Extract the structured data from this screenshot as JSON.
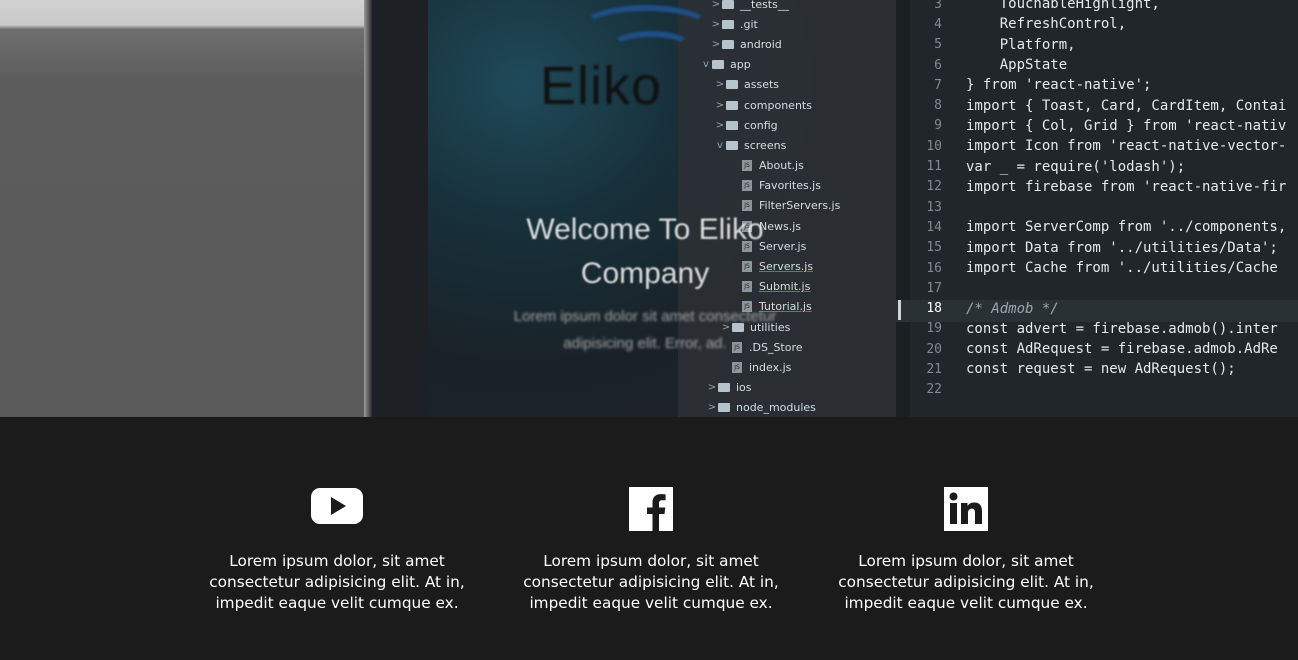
{
  "hero": {
    "logo_text": "Eliko",
    "welcome_line1": "Welcome To Eliko",
    "welcome_line2": "Company",
    "subtitle": "Lorem ipsum dolor sit amet consectetur adipisicing elit. Error, ad.",
    "file_tree": [
      {
        "type": "folder",
        "name": "__tests__",
        "chev": ">"
      },
      {
        "type": "folder",
        "name": ".git",
        "chev": ">"
      },
      {
        "type": "folder",
        "name": "android",
        "chev": ">"
      },
      {
        "type": "folder",
        "name": "app",
        "chev": "v"
      },
      {
        "type": "folder",
        "name": "assets",
        "chev": ">"
      },
      {
        "type": "folder",
        "name": "components",
        "chev": ">"
      },
      {
        "type": "folder",
        "name": "config",
        "chev": ">"
      },
      {
        "type": "folder",
        "name": "screens",
        "chev": "v"
      },
      {
        "type": "file",
        "name": "About.js"
      },
      {
        "type": "file",
        "name": "Favorites.js"
      },
      {
        "type": "file",
        "name": "FilterServers.js"
      },
      {
        "type": "file",
        "name": "News.js"
      },
      {
        "type": "file",
        "name": "Server.js"
      },
      {
        "type": "file",
        "name": "Servers.js"
      },
      {
        "type": "file",
        "name": "Submit.js"
      },
      {
        "type": "file",
        "name": "Tutorial.js"
      },
      {
        "type": "folder",
        "name": "utilities",
        "chev": ">"
      },
      {
        "type": "file",
        "name": ".DS_Store"
      },
      {
        "type": "file",
        "name": "index.js"
      },
      {
        "type": "folder",
        "name": "ios",
        "chev": ">"
      },
      {
        "type": "folder",
        "name": "node_modules",
        "chev": ">"
      }
    ],
    "code_lines": [
      {
        "ln": "3",
        "code": "    TouchableHighlight,"
      },
      {
        "ln": "4",
        "code": "    RefreshControl,"
      },
      {
        "ln": "5",
        "code": "    Platform,"
      },
      {
        "ln": "6",
        "code": "    AppState"
      },
      {
        "ln": "7",
        "code": "} from 'react-native';"
      },
      {
        "ln": "8",
        "code": "import { Toast, Card, CardItem, Contai"
      },
      {
        "ln": "9",
        "code": "import { Col, Grid } from 'react-nativ"
      },
      {
        "ln": "10",
        "code": "import Icon from 'react-native-vector-"
      },
      {
        "ln": "11",
        "code": "var _ = require('lodash');"
      },
      {
        "ln": "12",
        "code": "import firebase from 'react-native-fir"
      },
      {
        "ln": "13",
        "code": ""
      },
      {
        "ln": "14",
        "code": "import ServerComp from '../components,"
      },
      {
        "ln": "15",
        "code": "import Data from '../utilities/Data';"
      },
      {
        "ln": "16",
        "code": "import Cache from '../utilities/Cache"
      },
      {
        "ln": "17",
        "code": ""
      },
      {
        "ln": "18",
        "code": "/* Admob */"
      },
      {
        "ln": "19",
        "code": "const advert = firebase.admob().inter"
      },
      {
        "ln": "20",
        "code": "const AdRequest = firebase.admob.AdRe"
      },
      {
        "ln": "21",
        "code": "const request = new AdRequest();"
      },
      {
        "ln": "22",
        "code": ""
      }
    ]
  },
  "features": [
    {
      "icon": "youtube-icon",
      "text": "Lorem ipsum dolor, sit amet consectetur adipisicing elit. At in, impedit eaque velit cumque ex."
    },
    {
      "icon": "facebook-icon",
      "text": "Lorem ipsum dolor, sit amet consectetur adipisicing elit. At in, impedit eaque velit cumque ex."
    },
    {
      "icon": "linkedin-icon",
      "text": "Lorem ipsum dolor, sit amet consectetur adipisicing elit. At in, impedit eaque velit cumque ex."
    }
  ],
  "colors": {
    "background": "#1b1b1b",
    "text": "#ffffff",
    "code_bg": "#202629"
  }
}
